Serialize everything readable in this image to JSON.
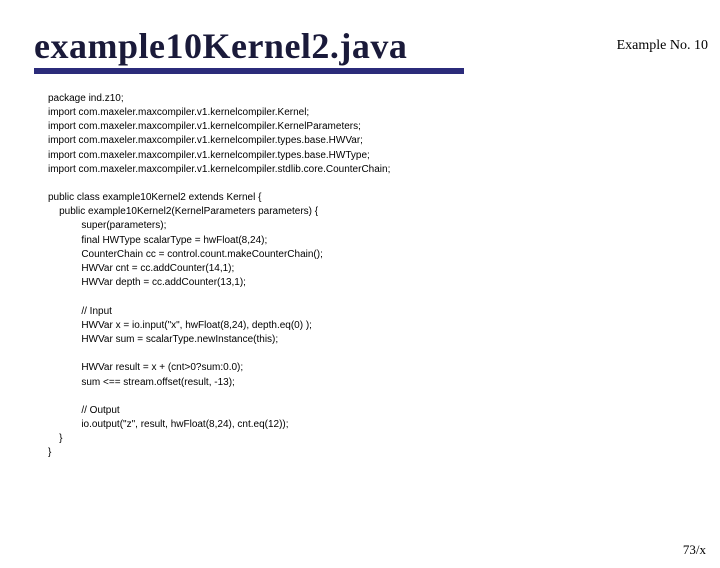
{
  "header": {
    "example_label": "Example No. 10"
  },
  "title": "example10Kernel2.java",
  "code": {
    "package_line": "package ind.z10;",
    "imports": [
      "import com.maxeler.maxcompiler.v1.kernelcompiler.Kernel;",
      "import com.maxeler.maxcompiler.v1.kernelcompiler.KernelParameters;",
      "import com.maxeler.maxcompiler.v1.kernelcompiler.types.base.HWVar;",
      "import com.maxeler.maxcompiler.v1.kernelcompiler.types.base.HWType;",
      "import com.maxeler.maxcompiler.v1.kernelcompiler.stdlib.core.CounterChain;"
    ],
    "class_decl": "public class example10Kernel2 extends Kernel {",
    "ctor_decl": "    public example10Kernel2(KernelParameters parameters) {",
    "body": [
      "            super(parameters);",
      "            final HWType scalarType = hwFloat(8,24);",
      "            CounterChain cc = control.count.makeCounterChain();",
      "            HWVar cnt = cc.addCounter(14,1);",
      "            HWVar depth = cc.addCounter(13,1);"
    ],
    "input_comment": "            // Input",
    "input_lines": [
      "            HWVar x = io.input(\"x\", hwFloat(8,24), depth.eq(0) );",
      "            HWVar sum = scalarType.newInstance(this);"
    ],
    "result_lines": [
      "            HWVar result = x + (cnt>0?sum:0.0);",
      "            sum <== stream.offset(result, -13);"
    ],
    "output_comment": "            // Output",
    "output_line": "            io.output(\"z\", result, hwFloat(8,24), cnt.eq(12));",
    "close_ctor": "    }",
    "close_class": "}"
  },
  "footer": {
    "page_indicator": "73/x"
  }
}
